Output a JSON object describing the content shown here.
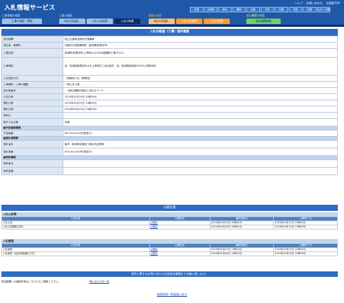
{
  "header": {
    "title": "入札情報サービス",
    "links": [
      "ヘルプ",
      "お問い合わせ",
      "全国版TOP"
    ],
    "regions": [
      "全国",
      "北海道",
      "東北",
      "関東",
      "北陸",
      "中部",
      "近畿",
      "中国",
      "四国",
      "九州・沖縄",
      "",
      "",
      "",
      "",
      "",
      "",
      "近畿",
      "中国",
      "四国",
      "九州・沖縄"
    ]
  },
  "categories": {
    "cat1": {
      "title": "工事情報の検索",
      "tab": "工事の検索・閲覧"
    },
    "cat2": {
      "title": "工事の検索",
      "tabs": [
        "発注の見通し",
        "入札公告検索",
        "入札の結果"
      ]
    },
    "cat3": {
      "title": "業務の検索",
      "tabs": [
        "発注の見通し",
        "入札公告検索",
        "入札の結果"
      ]
    },
    "cat4": {
      "title": "発注機関の検索",
      "tab": "発注機関情報"
    }
  },
  "main": {
    "title": "入札の経過（工事）案件概要",
    "rows": [
      {
        "label": "発注機関",
        "value": "国土交通省北陸地方整備局"
      },
      {
        "label": "発注者・事務所",
        "value": "羽越河川国道事務所（新潟県新発田市）"
      },
      {
        "label": "工事名称",
        "value": "新潟県(新発田市)上神部(土)(26)河道掘削工事(その1)"
      },
      {
        "label": "工事場所",
        "value": "自：新潟県新発田市大字上神部字三反田地先　至：新潟県新発田市大字上神部地先"
      },
      {
        "label": "入札契約方式",
        "value": "一般競争入札（標準型）"
      },
      {
        "label": "工事種別／工事の種類",
        "value": "一般土木工事"
      },
      {
        "label": "設計書番号",
        "value": "　※発注機関が独自に定めるコード"
      },
      {
        "label": "公告日時",
        "value": "2024年02月29日 10時00分"
      },
      {
        "label": "開札日時",
        "value": "2024年03月19日 13時00分"
      },
      {
        "label": "開札日時",
        "value": "2024年04月15日 10時00分"
      },
      {
        "label": "契約日",
        "value": ""
      },
      {
        "label": "電子入札対象",
        "value": "対象"
      }
    ],
    "group1": "■予定価格情報",
    "rows2": [
      {
        "label": "予定価格",
        "value": "587,610,000円(税抜き)"
      }
    ],
    "group2": "■落札者情報",
    "rows3": [
      {
        "label": "落札者名",
        "value": "東洋・新潟特定建設工事共同企業体"
      },
      {
        "label": "落札価格",
        "value": "540,000,000円(税抜き)"
      }
    ],
    "group3": "■契約情報",
    "rows4": [
      {
        "label": "契約者名",
        "value": ""
      },
      {
        "label": "契約金額",
        "value": ""
      }
    ]
  },
  "documents": {
    "title": "公開文書",
    "section1": "入札公告等",
    "section2": "入札経過",
    "headers": [
      "文書名称",
      "公開状況",
      "最終更新日",
      "公開終了日"
    ],
    "rows1": [
      {
        "name": "入札公告",
        "status": "公開中",
        "updated": "2024年02月29日 10時00分",
        "end": "2025年03月31日 23時59分"
      },
      {
        "name": "入札公告閲覧文書1",
        "status": "公開中",
        "updated": "2024年02月29日 10時00分",
        "end": "2025年03月31日 23時59分"
      }
    ],
    "rows2": [
      {
        "name": "入札調書",
        "status": "公開中",
        "updated": "2024年04月22日 13時19分",
        "end": "2025年03月31日 23時59分"
      },
      {
        "name": "入札調書（総合評価落札方式）",
        "status": "公開中",
        "updated": "2024年05月08日 13時19分",
        "end": "2025年03月31日 23時59分"
      }
    ]
  },
  "contact": {
    "bar": "案件に関するお問い合わせは各発注機関までお願い致します。",
    "label": "発注機関への連絡先等はこちらからご確認ください。",
    "link": "問い合わせ先一覧"
  },
  "back": "検索結果一覧画面に戻る",
  "colors": {
    "brand": "#1f58a8",
    "section": "#2f6cc2",
    "tab_orange": "#ff9a2b",
    "tab_green": "#6fd06a"
  }
}
